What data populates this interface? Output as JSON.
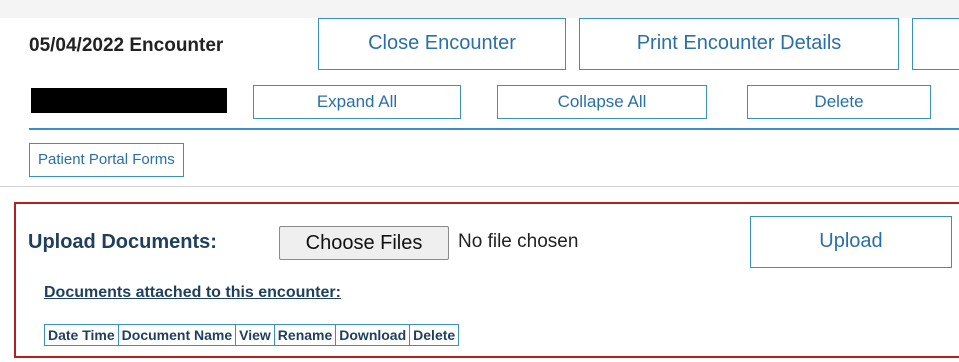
{
  "encounter": {
    "title": "05/04/2022 Encounter",
    "close_label": "Close Encounter",
    "print_label": "Print Encounter Details"
  },
  "actions": {
    "expand_all": "Expand All",
    "collapse_all": "Collapse All",
    "delete": "Delete"
  },
  "portal_forms_label": "Patient Portal Forms",
  "upload": {
    "label": "Upload Documents:",
    "choose_files": "Choose Files",
    "file_status": "No file chosen",
    "upload_button": "Upload",
    "attached_heading": "Documents attached to this encounter:",
    "columns": [
      "Date Time",
      "Document Name",
      "View",
      "Rename",
      "Download",
      "Delete"
    ]
  },
  "colors": {
    "accent": "#3b8fc4",
    "button_text": "#2a6fa8",
    "section_border": "#b51f24",
    "heading_text": "#1e3f5e"
  }
}
